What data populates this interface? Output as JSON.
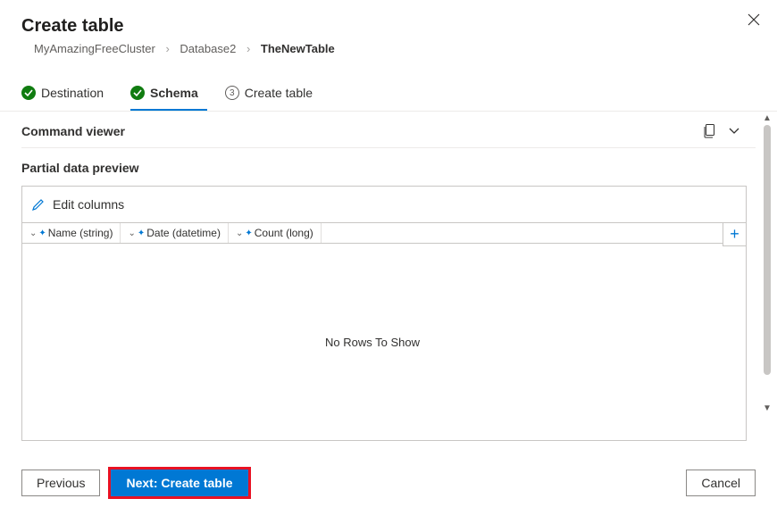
{
  "header": {
    "title": "Create table"
  },
  "breadcrumb": {
    "items": [
      "MyAmazingFreeCluster",
      "Database2",
      "TheNewTable"
    ]
  },
  "steps": [
    {
      "label": "Destination",
      "state": "complete"
    },
    {
      "label": "Schema",
      "state": "complete",
      "active": true
    },
    {
      "label": "Create table",
      "state": "pending",
      "number": "3"
    }
  ],
  "sections": {
    "command_viewer": "Command viewer",
    "partial_data_preview": "Partial data preview",
    "edit_columns": "Edit columns"
  },
  "columns": [
    {
      "label": "Name (string)"
    },
    {
      "label": "Date (datetime)"
    },
    {
      "label": "Count (long)"
    }
  ],
  "table": {
    "empty_message": "No Rows To Show"
  },
  "footer": {
    "previous": "Previous",
    "next": "Next: Create table",
    "cancel": "Cancel"
  }
}
